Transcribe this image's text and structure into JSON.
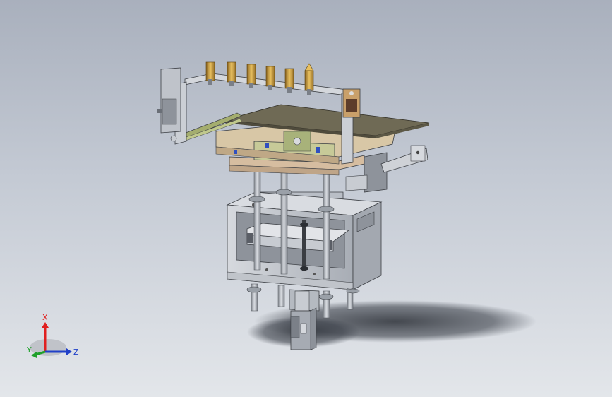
{
  "viewport": {
    "colors": {
      "background_top": "#a9b0bd",
      "background_bottom": "#e3e6ea",
      "frame_steel": "#c8ccd2",
      "plate_tan": "#dcc6a8",
      "plate_green": "#c9cfa0",
      "top_plate": "#6f6a55",
      "brass": "#c79a3a",
      "shadow": "#3a3f48"
    },
    "model_icon": "cad-assembly-model"
  },
  "triad": {
    "x_label": "X",
    "y_label": "Y",
    "z_label": "Z",
    "colors": {
      "x": "#e02020",
      "y": "#1fa02a",
      "z": "#2040c8"
    }
  }
}
